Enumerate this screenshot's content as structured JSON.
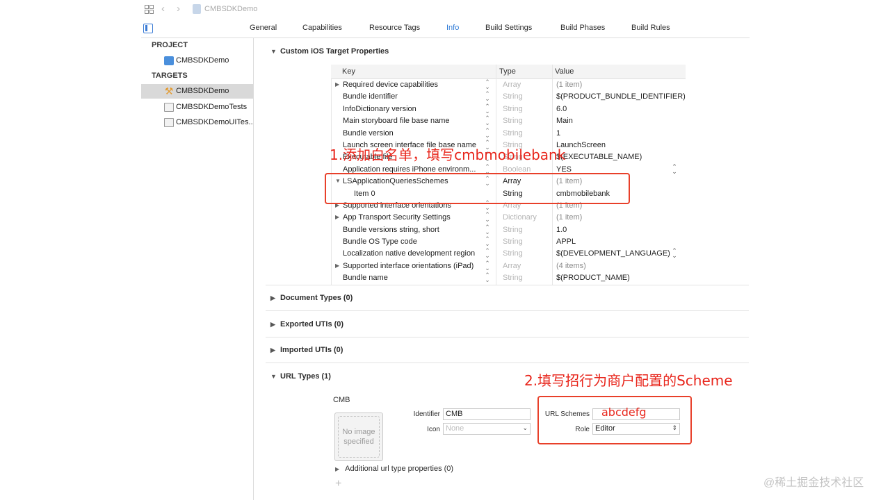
{
  "toolbar": {
    "breadcrumb": "CMBSDKDemo"
  },
  "tabs": [
    "General",
    "Capabilities",
    "Resource Tags",
    "Info",
    "Build Settings",
    "Build Phases",
    "Build Rules"
  ],
  "active_tab": "Info",
  "sidebar": {
    "project_header": "PROJECT",
    "project": "CMBSDKDemo",
    "targets_header": "TARGETS",
    "targets": [
      "CMBSDKDemo",
      "CMBSDKDemoTests",
      "CMBSDKDemoUITes..."
    ]
  },
  "custom_props": {
    "title": "Custom iOS Target Properties",
    "headers": {
      "key": "Key",
      "type": "Type",
      "value": "Value"
    },
    "rows": [
      {
        "key": "Required device capabilities",
        "type": "Array",
        "value": "(1 item)"
      },
      {
        "key": "Bundle identifier",
        "type": "String",
        "value": "$(PRODUCT_BUNDLE_IDENTIFIER)"
      },
      {
        "key": "InfoDictionary version",
        "type": "String",
        "value": "6.0"
      },
      {
        "key": "Main storyboard file base name",
        "type": "String",
        "value": "Main"
      },
      {
        "key": "Bundle version",
        "type": "String",
        "value": "1"
      },
      {
        "key": "Launch screen interface file base name",
        "type": "String",
        "value": "LaunchScreen"
      },
      {
        "key": "Executable file",
        "type": "String",
        "value": "$(EXECUTABLE_NAME)"
      },
      {
        "key": "Application requires iPhone environm...",
        "type": "Boolean",
        "value": "YES"
      },
      {
        "key": "LSApplicationQueriesSchemes",
        "type": "Array",
        "value": "(1 item)"
      },
      {
        "key": "Item 0",
        "type": "String",
        "value": "cmbmobilebank"
      },
      {
        "key": "Supported interface orientations",
        "type": "Array",
        "value": "(1 item)"
      },
      {
        "key": "App Transport Security Settings",
        "type": "Dictionary",
        "value": "(1 item)"
      },
      {
        "key": "Bundle versions string, short",
        "type": "String",
        "value": "1.0"
      },
      {
        "key": "Bundle OS Type code",
        "type": "String",
        "value": "APPL"
      },
      {
        "key": "Localization native development region",
        "type": "String",
        "value": "$(DEVELOPMENT_LANGUAGE)"
      },
      {
        "key": "Supported interface orientations (iPad)",
        "type": "Array",
        "value": "(4 items)"
      },
      {
        "key": "Bundle name",
        "type": "String",
        "value": "$(PRODUCT_NAME)"
      }
    ]
  },
  "sections": {
    "document_types": "Document Types (0)",
    "exported_utis": "Exported UTIs (0)",
    "imported_utis": "Imported UTIs (0)",
    "url_types": "URL Types (1)"
  },
  "url_type": {
    "name": "CMB",
    "no_image": "No image specified",
    "identifier_label": "Identifier",
    "identifier_value": "CMB",
    "icon_label": "Icon",
    "icon_placeholder": "None",
    "url_schemes_label": "URL Schemes",
    "url_schemes_value": "abcdefg",
    "role_label": "Role",
    "role_value": "Editor",
    "additional": "Additional url type properties (0)"
  },
  "annotations": {
    "note1": "1.添加白名单，填写cmbmobilebank",
    "note2": "2.填写招行为商户配置的Scheme"
  },
  "watermark": "@稀土掘金技术社区",
  "colors": {
    "accent": "#2f7bd6",
    "annotation": "#e8402a",
    "selected_row": "#d9d9d9"
  }
}
